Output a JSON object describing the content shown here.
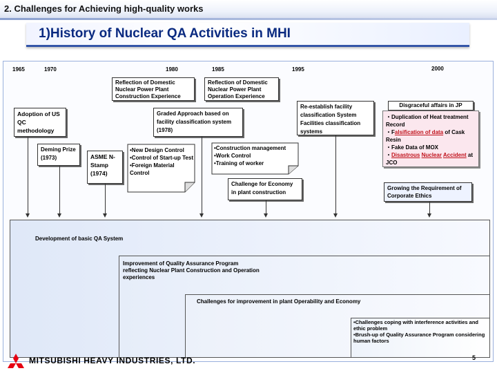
{
  "header": {
    "title": "2. Challenges for Achieving high-quality works"
  },
  "banner": {
    "title": "1)History of Nuclear QA Activities in MHI"
  },
  "timeline": {
    "years": [
      "1965",
      "1970",
      "1980",
      "1985",
      "1995",
      "2000"
    ]
  },
  "boxes": {
    "reflection_construction": "Reflection of Domestic Nuclear Power Plant Construction Experience",
    "reflection_operation": "Reflection of Domestic Nuclear Power Plant Operation Experience",
    "adoption": "Adoption of US QC methodology",
    "graded": "Graded Approach based on facility classification system (1978)",
    "reestablish": "Re-establish facility classification System Facilities classification systems",
    "disgraceful_title": "Disgraceful affairs in JP",
    "disgraceful_1": "・Duplication of Heat treatment Record",
    "disgraceful_2a": "・F",
    "disgraceful_2b": "alsification of data",
    "disgraceful_2c": " of Cask Resin",
    "disgraceful_3": "・Fake Data of MOX",
    "disgraceful_4a": "・",
    "disgraceful_4b": "Disastrous",
    "disgraceful_4c": " ",
    "disgraceful_4d": "Nuclear",
    "disgraceful_4e": " ",
    "disgraceful_4f": "Accident",
    "disgraceful_4g": " at JCO",
    "deming": "Deming Prize (1973)",
    "asme": "ASME N-Stamp (1974)",
    "design_1": "•New Design Control",
    "design_2": "•Control of Start-up Test",
    "design_3": "•Foreign Material Control",
    "mgmt_1": "•Construction management",
    "mgmt_2": "•Work Control",
    "mgmt_3": "•Training of worker",
    "economy": "Challenge for Economy in plant construction",
    "ethics": "Growing the Requirement of Corporate Ethics"
  },
  "stairs": {
    "step1": "Development of basic QA System",
    "step2": "Improvement of Quality Assurance Program reflecting Nuclear Plant Construction and Operation experiences",
    "step3": "Challenges for improvement in plant Operability and Economy",
    "step4a": "•Challenges coping with interference activities and ethic problem",
    "step4b": "•Brush-up of Quality Assurance Program considering human factors"
  },
  "footer": {
    "company": "MITSUBISHI HEAVY INDUSTRIES, LTD.",
    "page": "5"
  },
  "colors": {
    "accent": "#0a2a80",
    "logo_red": "#e60012",
    "highlight_red": "#c0101a",
    "pink": "#fbe7ee"
  }
}
